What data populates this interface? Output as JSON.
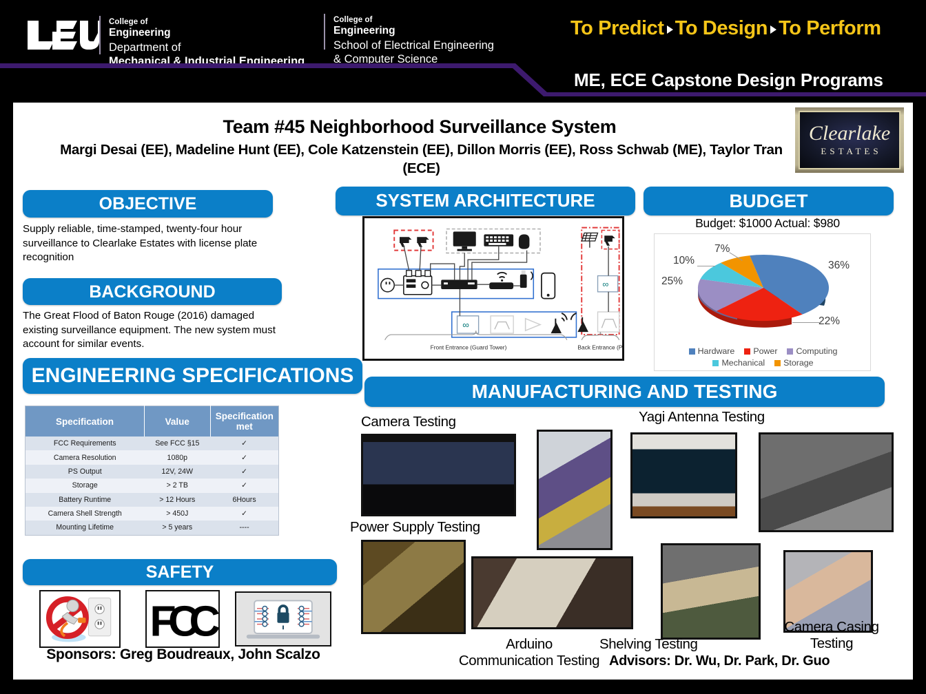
{
  "header": {
    "lsu_wordmark": "LSU",
    "me_unit": {
      "line1": "College of",
      "line2": "Engineering",
      "line3": "Department of",
      "line4": "Mechanical & Industrial Engineering"
    },
    "ece_unit": {
      "line1": "College of",
      "line2": "Engineering",
      "line3": "School of Electrical Engineering",
      "line4": "& Computer Science"
    },
    "tagline": {
      "part1": "To Predict",
      "part2": "To Design",
      "part3": "To Perform"
    },
    "program_title": "ME, ECE Capstone Design Programs",
    "colors": {
      "purple": "#3d1a6e",
      "gold": "#f5c518",
      "background": "#000000"
    }
  },
  "poster": {
    "title": "Team #45 Neighborhood Surveillance System",
    "authors": "Margi Desai (EE), Madeline Hunt (EE), Cole Katzenstein (EE), Dillon Morris (EE), Ross Schwab (ME), Taylor Tran (ECE)",
    "client_logo": {
      "name": "Clearlake",
      "sub": "ESTATES"
    },
    "accent_blue": "#0b7fc8"
  },
  "objective": {
    "heading": "OBJECTIVE",
    "text": "Supply reliable, time-stamped, twenty-four hour surveillance to Clearlake Estates with license plate recognition"
  },
  "background": {
    "heading": "BACKGROUND",
    "text": "The Great Flood of Baton Rouge (2016) damaged existing surveillance equipment. The new system must account for similar events."
  },
  "specifications": {
    "heading": "ENGINEERING  SPECIFICATIONS",
    "columns": [
      "Specification",
      "Value",
      "Specification met"
    ],
    "rows": [
      [
        "FCC Requirements",
        "See FCC §15",
        "✓"
      ],
      [
        "Camera  Resolution",
        "1080p",
        "✓"
      ],
      [
        "PS Output",
        "12V, 24W",
        "✓"
      ],
      [
        "Storage",
        "> 2 TB",
        "✓"
      ],
      [
        "Battery  Runtime",
        "> 12 Hours",
        "6Hours"
      ],
      [
        "Camera  Shell Strength",
        "> 450J",
        "✓"
      ],
      [
        "Mounting  Lifetime",
        "> 5 years",
        "----"
      ]
    ]
  },
  "safety": {
    "heading": "SAFETY",
    "icons": [
      "no-wet-outlet-icon",
      "fcc-logo-icon",
      "cyber-lock-icon"
    ],
    "sponsors": "Sponsors: Greg Boudreaux, John Scalzo"
  },
  "architecture": {
    "heading": "SYSTEM ARCHITECTURE",
    "label_front": "Front Entrance (Guard Tower)",
    "label_back": "Back Entrance (Pole)"
  },
  "budget": {
    "heading": "BUDGET",
    "summary": "Budget: $1000     Actual: $980",
    "budget_amount": "$1000",
    "actual_amount": "$980"
  },
  "chart_data": {
    "type": "pie",
    "title": "",
    "categories": [
      "Hardware",
      "Power",
      "Computing",
      "Mechanical",
      "Storage"
    ],
    "values": [
      36,
      22,
      25,
      10,
      7
    ],
    "labels": [
      "36%",
      "22%",
      "25%",
      "10%",
      "7%"
    ],
    "colors": [
      "#4f81bd",
      "#ee2211",
      "#9b8ec4",
      "#4bc8dd",
      "#f29400"
    ],
    "legend_position": "bottom",
    "grid": false,
    "units": "percent"
  },
  "manufacturing": {
    "heading": "MANUFACTURING AND TESTING",
    "captions": {
      "camera": "Camera Testing",
      "power_supply": "Power Supply Testing",
      "yagi": "Yagi Antenna Testing",
      "arduino": "Arduino\nCommunication Testing",
      "shelving": "Shelving Testing",
      "camera_casing": "Camera Casing\nTesting"
    },
    "advisors": "Advisors: Dr. Wu, Dr. Park, Dr. Guo"
  }
}
